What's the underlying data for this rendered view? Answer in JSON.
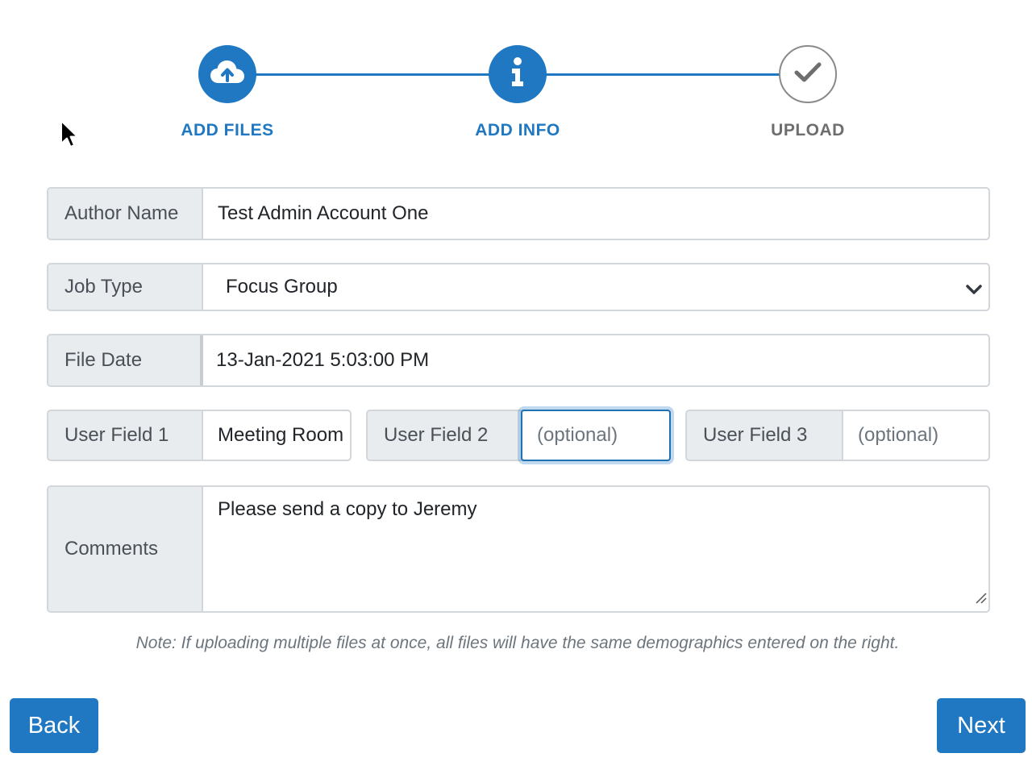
{
  "stepper": {
    "steps": [
      {
        "label": "ADD FILES",
        "icon": "cloud-upload-icon",
        "state": "active"
      },
      {
        "label": "ADD INFO",
        "icon": "info-icon",
        "state": "active"
      },
      {
        "label": "UPLOAD",
        "icon": "check-icon",
        "state": "pending"
      }
    ]
  },
  "form": {
    "author": {
      "label": "Author Name",
      "value": "Test Admin Account One"
    },
    "job_type": {
      "label": "Job Type",
      "value": "Focus Group"
    },
    "file_date": {
      "label": "File Date",
      "value": "13-Jan-2021 5:03:00 PM"
    },
    "user_field_1": {
      "label": "User Field 1",
      "value": "Meeting Room"
    },
    "user_field_2": {
      "label": "User Field 2",
      "placeholder": "(optional)"
    },
    "user_field_3": {
      "label": "User Field 3",
      "placeholder": "(optional)"
    },
    "comments": {
      "label": "Comments",
      "value": "Please send a copy to Jeremy"
    }
  },
  "note": "Note: If uploading multiple files at once, all files will have the same demographics entered on the right.",
  "buttons": {
    "back": "Back",
    "next": "Next"
  },
  "colors": {
    "accent": "#1f78c1",
    "pending": "#8a8a8a",
    "addon_bg": "#e9ecef"
  }
}
